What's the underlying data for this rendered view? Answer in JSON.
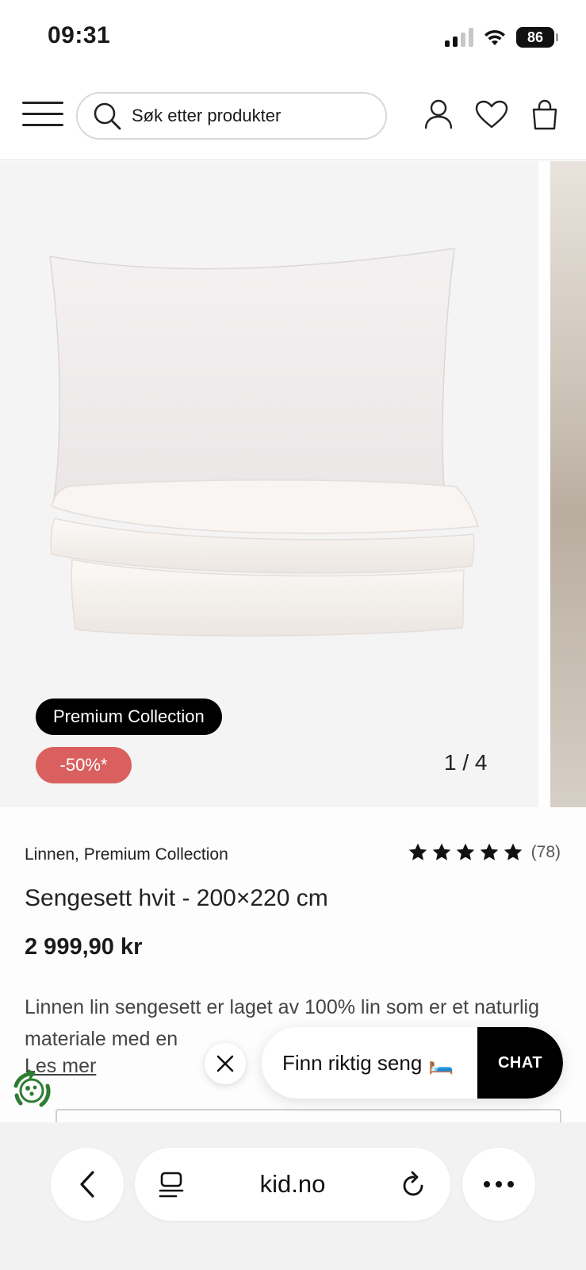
{
  "status_bar": {
    "time": "09:31",
    "battery": "86"
  },
  "header": {
    "search_placeholder": "Søk etter produkter",
    "icons": [
      "menu-icon",
      "search-icon",
      "user-icon",
      "heart-icon",
      "bag-icon"
    ]
  },
  "gallery": {
    "badge_collection": "Premium Collection",
    "badge_discount": "-50%*",
    "counter": "1 / 4"
  },
  "product": {
    "brand": "Linnen, Premium Collection",
    "rating_stars": 5,
    "review_count": "(78)",
    "title": "Sengesett hvit - 200×220 cm",
    "price": "2 999,90 kr",
    "description": "Linnen lin sengesett er laget av 100% lin som er et naturlig materiale med en",
    "read_more": "Les mer"
  },
  "chat": {
    "prompt": "Finn riktig seng",
    "prompt_emoji": "🛏️",
    "button": "CHAT"
  },
  "browser": {
    "url": "kid.no"
  },
  "colors": {
    "discount": "#d9605f",
    "badge_dark": "#000000",
    "eco_green": "#2e7d32"
  }
}
